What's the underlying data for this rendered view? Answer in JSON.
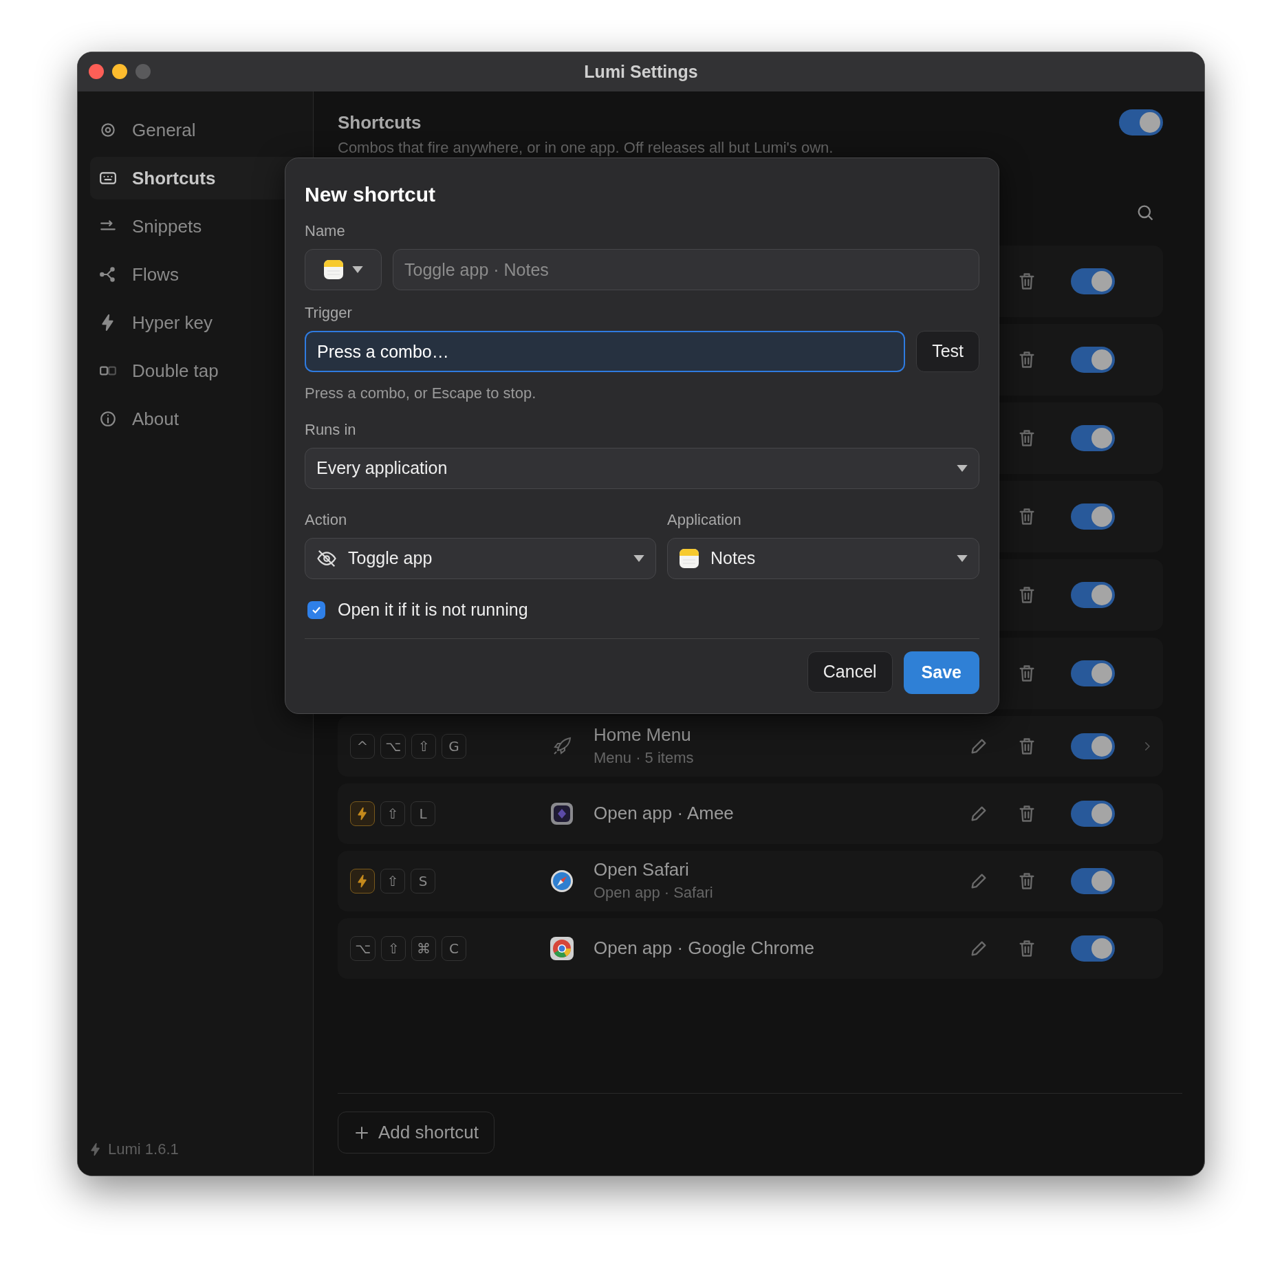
{
  "window": {
    "title": "Lumi Settings"
  },
  "sidebar": {
    "items": [
      {
        "label": "General",
        "selected": false
      },
      {
        "label": "Shortcuts",
        "selected": true
      },
      {
        "label": "Snippets",
        "selected": false
      },
      {
        "label": "Flows",
        "selected": false
      },
      {
        "label": "Hyper key",
        "selected": false
      },
      {
        "label": "Double tap",
        "selected": false
      },
      {
        "label": "About",
        "selected": false
      }
    ],
    "version": "Lumi 1.6.1"
  },
  "header": {
    "title": "Shortcuts",
    "subtitle": "Combos that fire anywhere, or in one app. Off releases all but Lumi's own.",
    "on": true
  },
  "shortcuts": [
    {
      "on": true
    },
    {
      "on": true
    },
    {
      "on": true
    },
    {
      "on": true
    },
    {
      "on": true
    },
    {
      "on": true
    },
    {
      "kind": "menu",
      "keys": [
        {
          "kind": "key",
          "label": "^"
        },
        {
          "kind": "key",
          "label": "⌥"
        },
        {
          "kind": "key",
          "label": "⇧"
        },
        {
          "kind": "key",
          "label": "G"
        }
      ],
      "title": "Home Menu",
      "subtitle": "Menu · 5 items",
      "on": true
    },
    {
      "kind": "action",
      "keys": [
        {
          "kind": "hyper"
        },
        {
          "kind": "key",
          "label": "⇧"
        },
        {
          "kind": "key",
          "label": "L"
        }
      ],
      "title": "Open app · Amee",
      "on": true
    },
    {
      "kind": "action",
      "keys": [
        {
          "kind": "hyper"
        },
        {
          "kind": "key",
          "label": "⇧"
        },
        {
          "kind": "key",
          "label": "S"
        }
      ],
      "title": "Open Safari",
      "subtitle": "Open app · Safari",
      "on": true
    },
    {
      "kind": "action",
      "keys": [
        {
          "kind": "key",
          "label": "⌥"
        },
        {
          "kind": "key",
          "label": "⇧"
        },
        {
          "kind": "key",
          "label": "⌘"
        },
        {
          "kind": "key",
          "label": "C"
        }
      ],
      "title": "Open app · Google Chrome",
      "on": true
    }
  ],
  "add_button": "Add shortcut",
  "dialog": {
    "title": "New shortcut",
    "name": {
      "label": "Name",
      "placeholder": "Toggle app · Notes"
    },
    "trigger": {
      "label": "Trigger",
      "value": "Press a combo…",
      "focused": true,
      "hint": "Press a combo, or Escape to stop.",
      "test_button": "Test"
    },
    "runs_in": {
      "label": "Runs in",
      "value": "Every application"
    },
    "action": {
      "label": "Action",
      "value": "Toggle app"
    },
    "application": {
      "label": "Application",
      "value": "Notes"
    },
    "open_if_not_running": {
      "label": "Open it if it is not running",
      "checked": true
    },
    "buttons": [
      {
        "label": "Cancel",
        "kind": "secondary"
      },
      {
        "label": "Save",
        "kind": "primary"
      }
    ]
  }
}
